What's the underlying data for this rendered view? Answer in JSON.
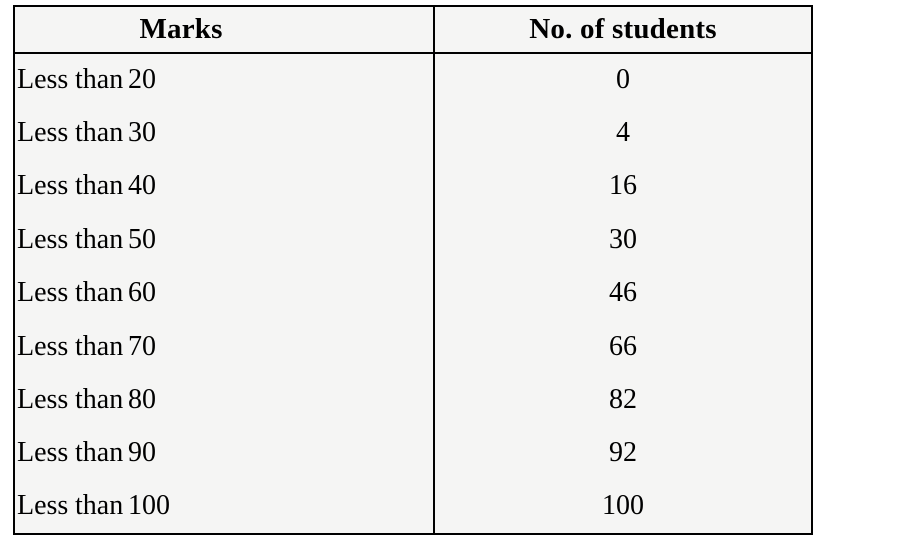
{
  "table": {
    "name": "cumulative-frequency-distribution",
    "columns": [
      {
        "key": "marks",
        "label": "Marks"
      },
      {
        "key": "students",
        "label": "No. of students"
      }
    ],
    "row_prefix": {
      "word1": "Less",
      "word2": "than"
    },
    "rows": [
      {
        "word1": "Less",
        "word2": "than",
        "bound": "20",
        "students": "0"
      },
      {
        "word1": "Less",
        "word2": "than",
        "bound": "30",
        "students": "4"
      },
      {
        "word1": "Less",
        "word2": "than",
        "bound": "40",
        "students": "16"
      },
      {
        "word1": "Less",
        "word2": "than",
        "bound": "50",
        "students": "30"
      },
      {
        "word1": "Less",
        "word2": "than",
        "bound": "60",
        "students": "46"
      },
      {
        "word1": "Less",
        "word2": "than",
        "bound": "70",
        "students": "66"
      },
      {
        "word1": "Less",
        "word2": "than",
        "bound": "80",
        "students": "82"
      },
      {
        "word1": "Less",
        "word2": "than",
        "bound": "90",
        "students": "92"
      },
      {
        "word1": "Less",
        "word2": "than",
        "bound": "100",
        "students": "100"
      }
    ]
  },
  "chart_data": {
    "type": "table",
    "title": "",
    "columns": [
      "Marks",
      "No. of students"
    ],
    "categories": [
      "Less than 20",
      "Less than 30",
      "Less than 40",
      "Less than 50",
      "Less than 60",
      "Less than 70",
      "Less than 80",
      "Less than 90",
      "Less than 100"
    ],
    "x": [
      20,
      30,
      40,
      50,
      60,
      70,
      80,
      90,
      100
    ],
    "values": [
      0,
      4,
      16,
      30,
      46,
      66,
      82,
      92,
      100
    ],
    "xlabel": "Marks",
    "ylabel": "No. of students",
    "ylim": [
      0,
      100
    ],
    "grid": false
  },
  "colors": {
    "page_background": "#ffffff",
    "table_background": "#f5f5f4",
    "border": "#000000",
    "text": "#000000"
  }
}
